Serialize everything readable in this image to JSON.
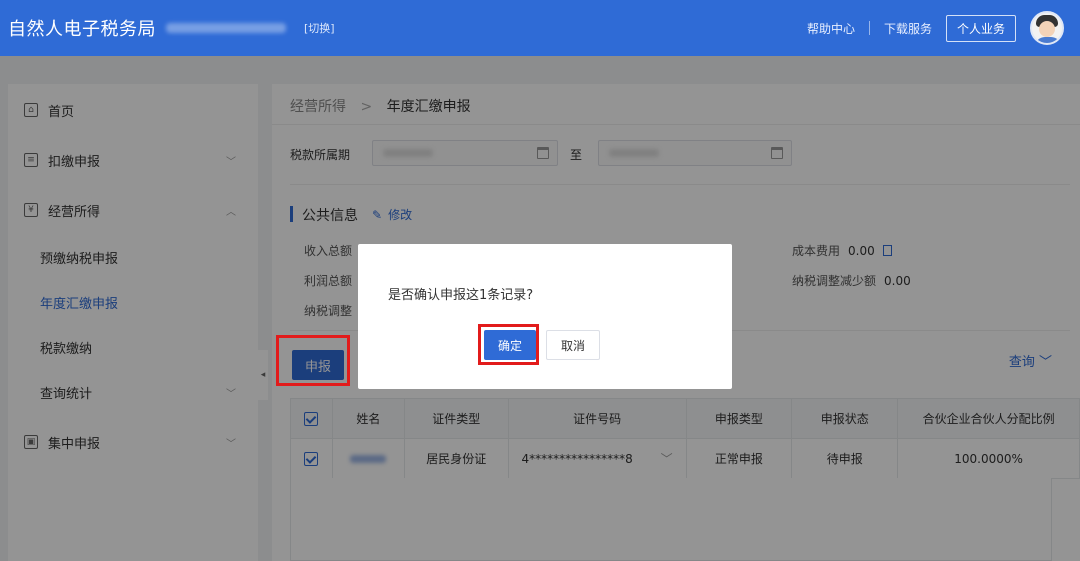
{
  "header": {
    "brand": "自然人电子税务局",
    "switch_label": "[切换]",
    "help": "帮助中心",
    "download": "下载服务",
    "personal": "个人业务",
    "accent": "#2f6bd6"
  },
  "sidebar": {
    "items": [
      {
        "label": "首页",
        "icon": "home-icon"
      },
      {
        "label": "扣缴申报",
        "icon": "document-icon"
      },
      {
        "label": "经营所得",
        "icon": "business-icon"
      },
      {
        "label": "查询统计"
      },
      {
        "label": "集中申报",
        "icon": "batch-icon"
      }
    ],
    "sub_items": [
      "预缴纳税申报",
      "年度汇缴申报",
      "税款缴纳"
    ],
    "active": "年度汇缴申报"
  },
  "breadcrumb": {
    "parent": "经营所得",
    "separator": ">",
    "current": "年度汇缴申报"
  },
  "filter": {
    "period_label": "税款所属期",
    "to_label": "至"
  },
  "public_info": {
    "title": "公共信息",
    "edit": "修改",
    "fields": {
      "income_total": "收入总额",
      "profit_total": "利润总额",
      "adjust_increase": "纳税调整",
      "cost_label": "成本费用",
      "cost_value": "0.00",
      "adjust_decrease_label": "纳税调整减少额",
      "adjust_decrease_value": "0.00"
    }
  },
  "actions": {
    "submit": "申报",
    "query": "查询"
  },
  "table": {
    "headers": [
      "姓名",
      "证件类型",
      "证件号码",
      "申报类型",
      "申报状态",
      "合伙企业合伙人分配比例"
    ],
    "rows": [
      {
        "id_type": "居民身份证",
        "id_number": "4****************8",
        "report_type": "正常申报",
        "status": "待申报",
        "ratio": "100.0000%"
      }
    ]
  },
  "dialog": {
    "message": "是否确认申报这1条记录?",
    "confirm": "确定",
    "cancel": "取消"
  }
}
